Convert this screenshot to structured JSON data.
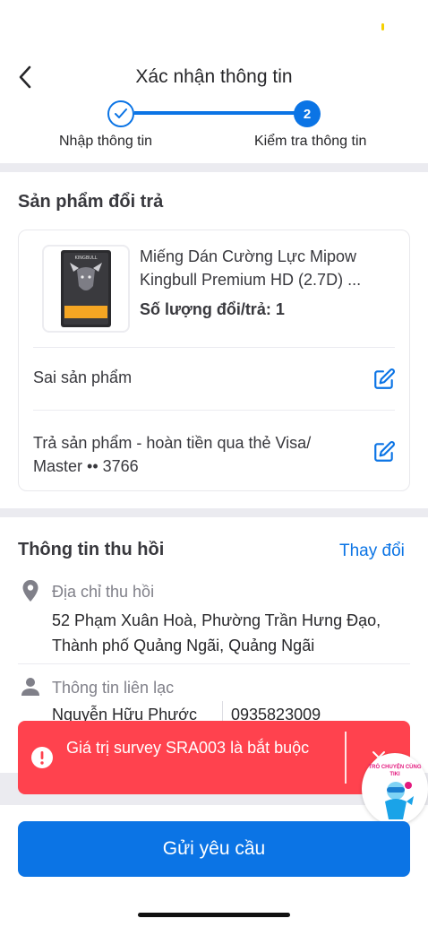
{
  "header": {
    "title": "Xác nhận thông tin"
  },
  "stepper": {
    "steps": [
      {
        "label": "Nhập thông tin",
        "state": "done"
      },
      {
        "label": "Kiểm tra thông tin",
        "number": "2",
        "state": "active"
      }
    ]
  },
  "product_section": {
    "title": "Sản phẩm đổi trả",
    "product": {
      "name": "Miếng Dán Cường Lực Mipow Kingbull Premium HD (2.7D) ...",
      "quantity": "Số lượng đổi/trả: 1",
      "thumb_brand": "KINGBULL"
    },
    "reason": "Sai sản phẩm",
    "refund_method": "Trả sản phẩm - hoàn tiền qua thẻ Visa/ Master •• 3766"
  },
  "pickup_section": {
    "title": "Thông tin thu hồi",
    "change_label": "Thay đổi",
    "address_label": "Địa chỉ thu hồi",
    "address": "52 Phạm Xuân Hoà, Phường Trần Hưng Đạo, Thành phố Quảng Ngãi, Quảng Ngãi",
    "contact_label": "Thông tin liên lạc",
    "contact_name": "Nguyễn Hữu Phước",
    "contact_phone": "0935823009"
  },
  "toast": {
    "message": "Giá trị survey SRA003 là bắt buộc"
  },
  "chat_widget": {
    "label": "TRÒ CHUYỆN CÙNG TIKI"
  },
  "footer": {
    "submit_label": "Gửi yêu cầu"
  },
  "colors": {
    "primary": "#0b74e5",
    "error": "#ff424e",
    "divider": "#ebebf0"
  }
}
